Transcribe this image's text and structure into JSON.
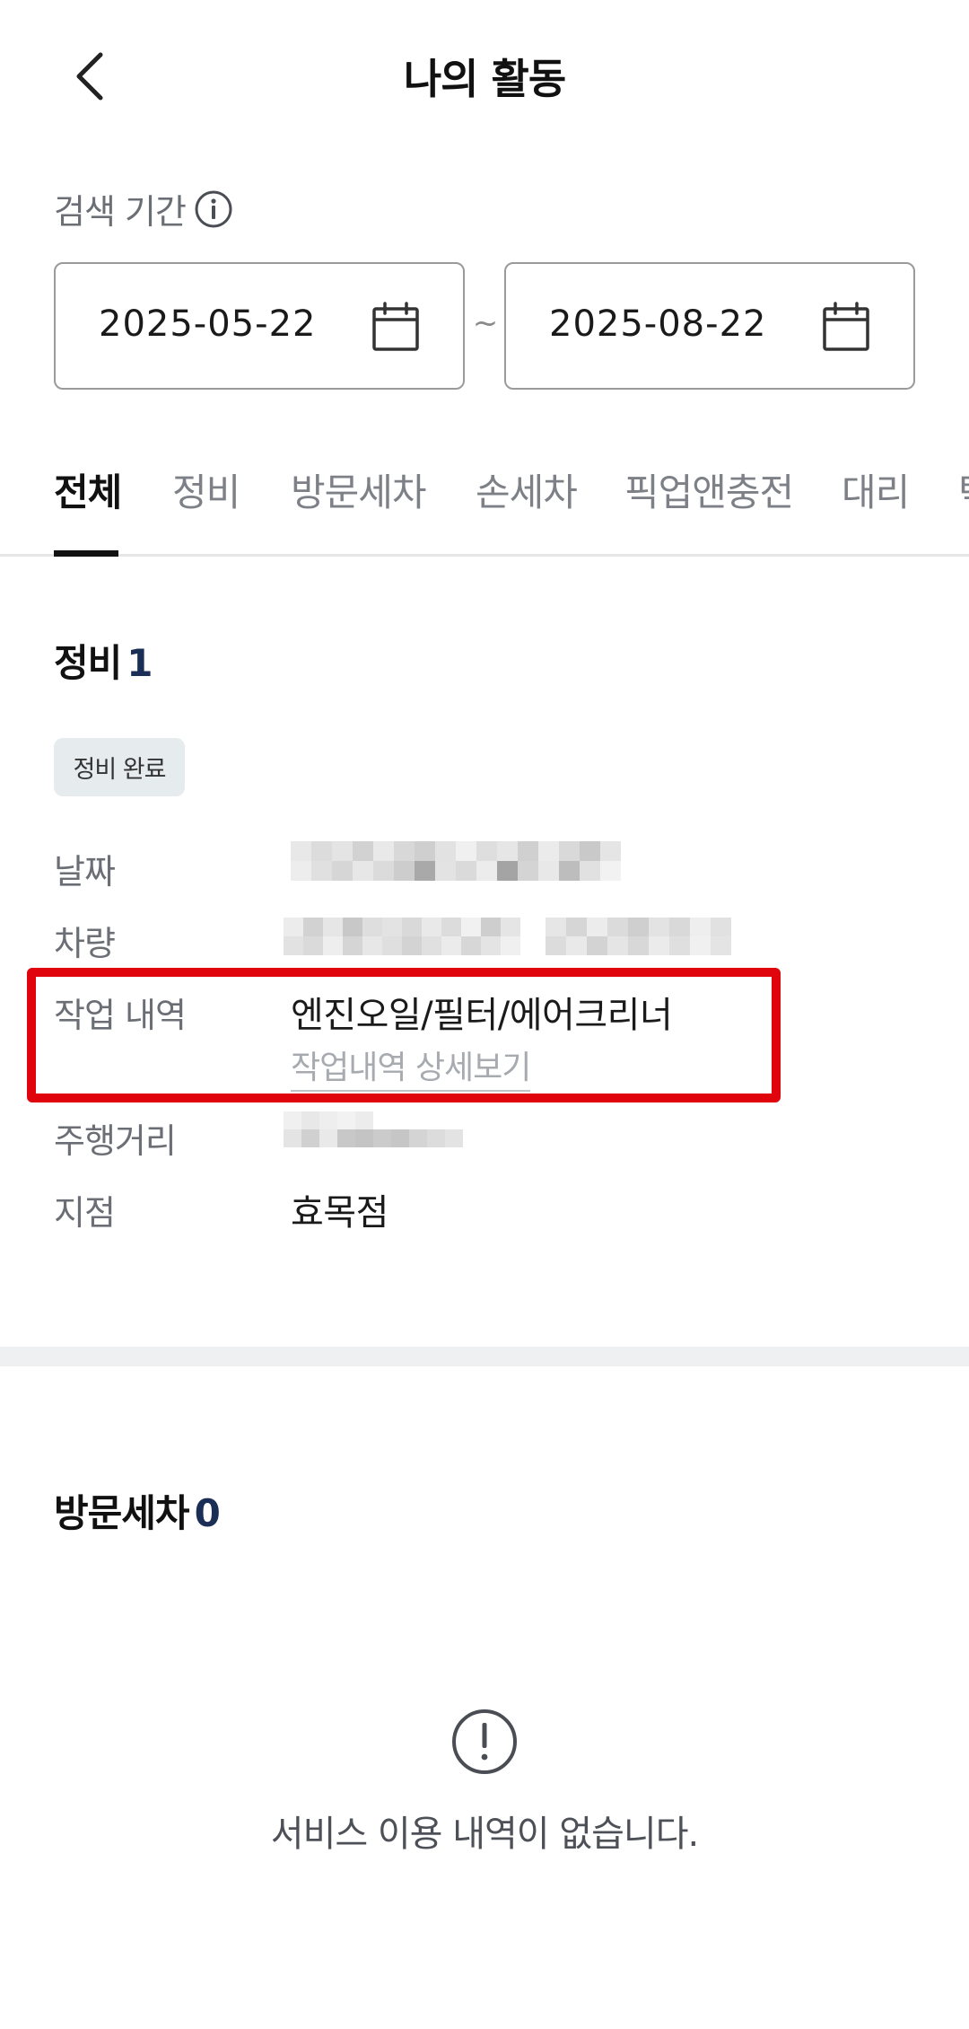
{
  "header": {
    "title": "나의 활동",
    "back_icon": "chevron-left-icon"
  },
  "search_period": {
    "label": "검색 기간",
    "start_date": "2025-05-22",
    "end_date": "2025-08-22",
    "separator": "~"
  },
  "tabs": [
    {
      "label": "전체",
      "active": true
    },
    {
      "label": "정비",
      "active": false
    },
    {
      "label": "방문세차",
      "active": false
    },
    {
      "label": "손세차",
      "active": false
    },
    {
      "label": "픽업앤충전",
      "active": false
    },
    {
      "label": "대리",
      "active": false
    },
    {
      "label": "탁",
      "active": false
    }
  ],
  "maintenance": {
    "title": "정비",
    "count": "1",
    "status": "정비 완료",
    "fields": {
      "date_label": "날짜",
      "vehicle_label": "차량",
      "work_label": "작업 내역",
      "work_value": "엔진오일/필터/에어크리너",
      "work_detail_link": "작업내역 상세보기",
      "mileage_label": "주행거리",
      "branch_label": "지점",
      "branch_value": "효목점"
    }
  },
  "visit_wash": {
    "title": "방문세차",
    "count": "0",
    "empty_message": "서비스 이용 내역이 없습니다."
  },
  "colors": {
    "accent_navy": "#1b2e55",
    "highlight_red": "#e0040c"
  }
}
